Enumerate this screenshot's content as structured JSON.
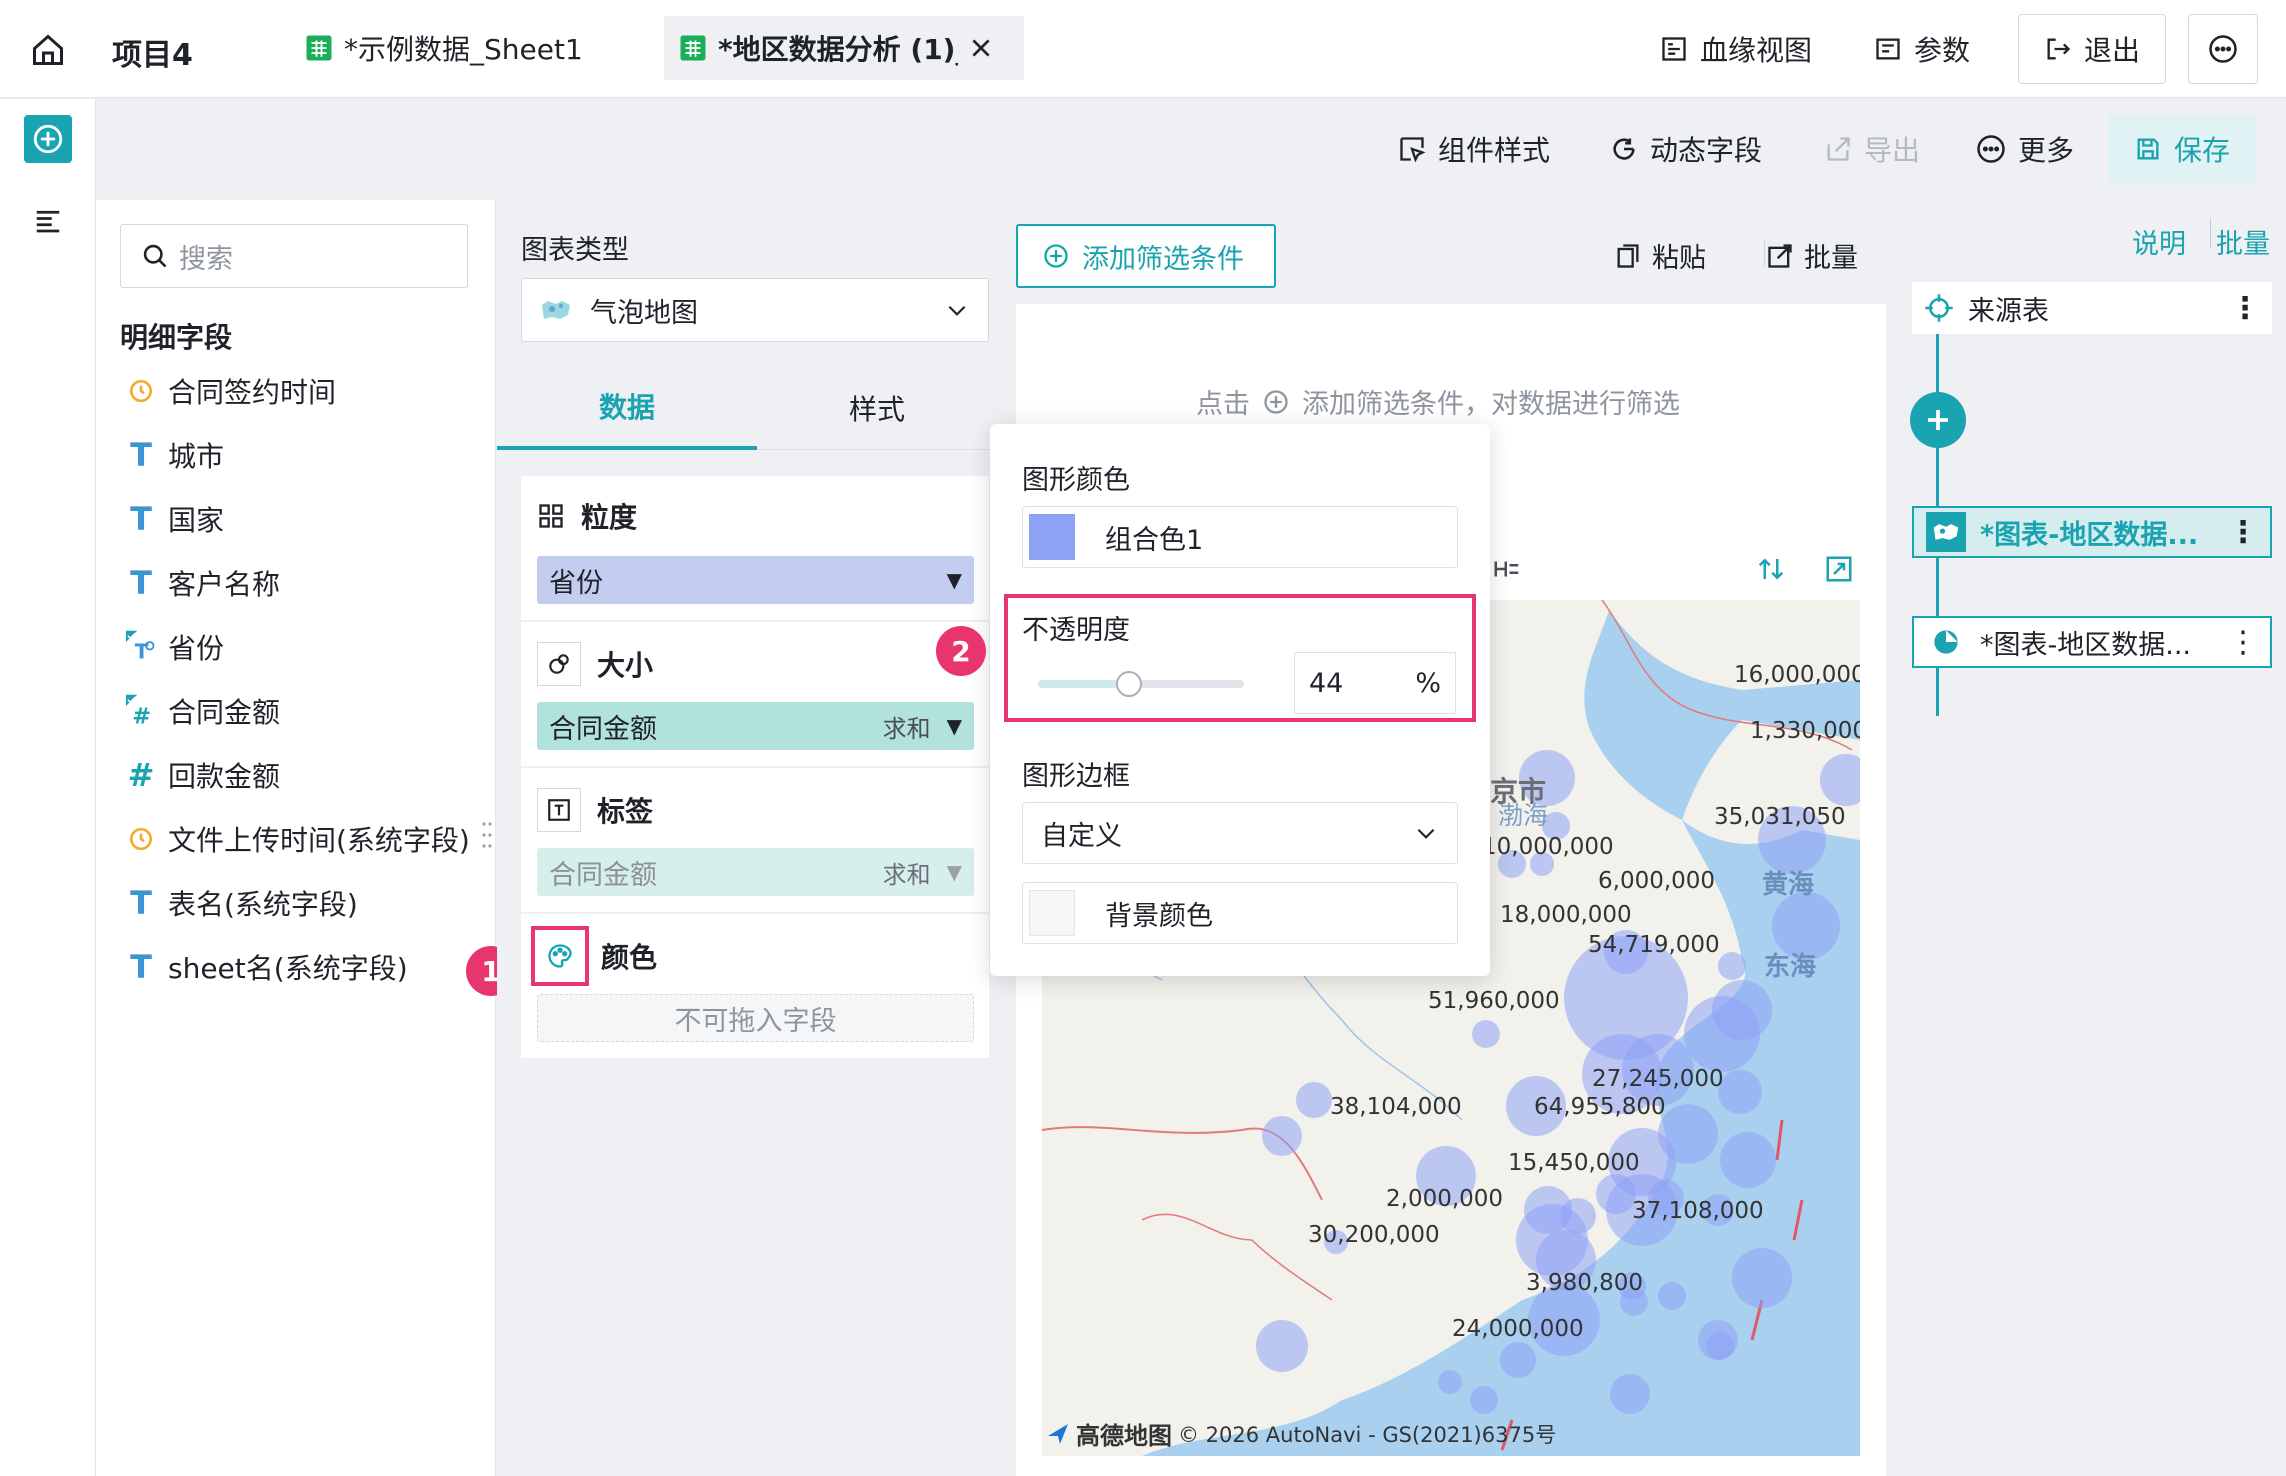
{
  "topbar": {
    "project": "项目4",
    "tabs": [
      {
        "label": "*示例数据_Sheet1"
      },
      {
        "label": "*地区数据分析 (1)_"
      }
    ],
    "buttons": {
      "lineage": "血缘视图",
      "params": "参数",
      "exit": "退出"
    }
  },
  "toolbar": {
    "style": "组件样式",
    "dynamic": "动态字段",
    "export": "导出",
    "more": "更多",
    "save": "保存"
  },
  "fieldpanel": {
    "search_placeholder": "搜索",
    "section": "明细字段",
    "fields": [
      {
        "label": "合同签约时间",
        "type": "time"
      },
      {
        "label": "城市",
        "type": "text"
      },
      {
        "label": "国家",
        "type": "text"
      },
      {
        "label": "客户名称",
        "type": "text"
      },
      {
        "label": "省份",
        "type": "geo"
      },
      {
        "label": "合同金额",
        "type": "number-checked"
      },
      {
        "label": "回款金额",
        "type": "number"
      },
      {
        "label": "文件上传时间(系统字段)",
        "type": "time"
      },
      {
        "label": "表名(系统字段)",
        "type": "text"
      },
      {
        "label": "sheet名(系统字段)",
        "type": "text"
      }
    ]
  },
  "config": {
    "chart_type_label": "图表类型",
    "chart_type": "气泡地图",
    "tabs": {
      "data": "数据",
      "style": "样式"
    },
    "granularity": {
      "label": "粒度",
      "value": "省份"
    },
    "size": {
      "label": "大小",
      "value": "合同金额",
      "agg": "求和"
    },
    "tag": {
      "label": "标签",
      "value": "合同金额",
      "agg": "求和"
    },
    "color": {
      "label": "颜色",
      "placeholder": "不可拖入字段"
    }
  },
  "filter": {
    "add_button": "添加筛选条件",
    "paste": "粘贴",
    "batch": "批量",
    "hint_prefix": "点击",
    "hint_suffix": "添加筛选条件，对数据进行筛选"
  },
  "popup": {
    "shape_color_label": "图形颜色",
    "shape_color_value": "组合色1",
    "opacity_label": "不透明度",
    "opacity_value": "44",
    "opacity_unit": "%",
    "opacity_fraction": 0.44,
    "border_label": "图形边框",
    "border_value": "自定义",
    "bg_color_label": "背景颜色"
  },
  "map": {
    "labels": {
      "beijing": "北京市",
      "bohai": "渤海",
      "huanghai": "黄海",
      "donghai": "东海"
    },
    "values": [
      "16,000,000",
      "1,330,000",
      "35,031,050",
      "10,000,000",
      "6,000,000",
      "18,000,000",
      "54,719,000",
      "51,960,000",
      "27,245,000",
      "38,104,000",
      "64,955,800",
      "15,450,000",
      "2,000,000",
      "37,108,000",
      "30,200,000",
      "3,980,800",
      "24,000,000"
    ],
    "attribution_brand": "高德地图",
    "attribution": "© 2026 AutoNavi - GS(2021)6375号"
  },
  "rightpanel": {
    "explain": "说明",
    "batch": "批量",
    "nodes": [
      {
        "label": "来源表"
      },
      {
        "label": "*图表-地区数据..."
      },
      {
        "label": "*图表-地区数据..."
      }
    ]
  },
  "badges": [
    "1",
    "2"
  ],
  "colors": {
    "accent": "#1aa3b0",
    "highlight": "#e8356d",
    "bubble": "#8ea2f5"
  }
}
